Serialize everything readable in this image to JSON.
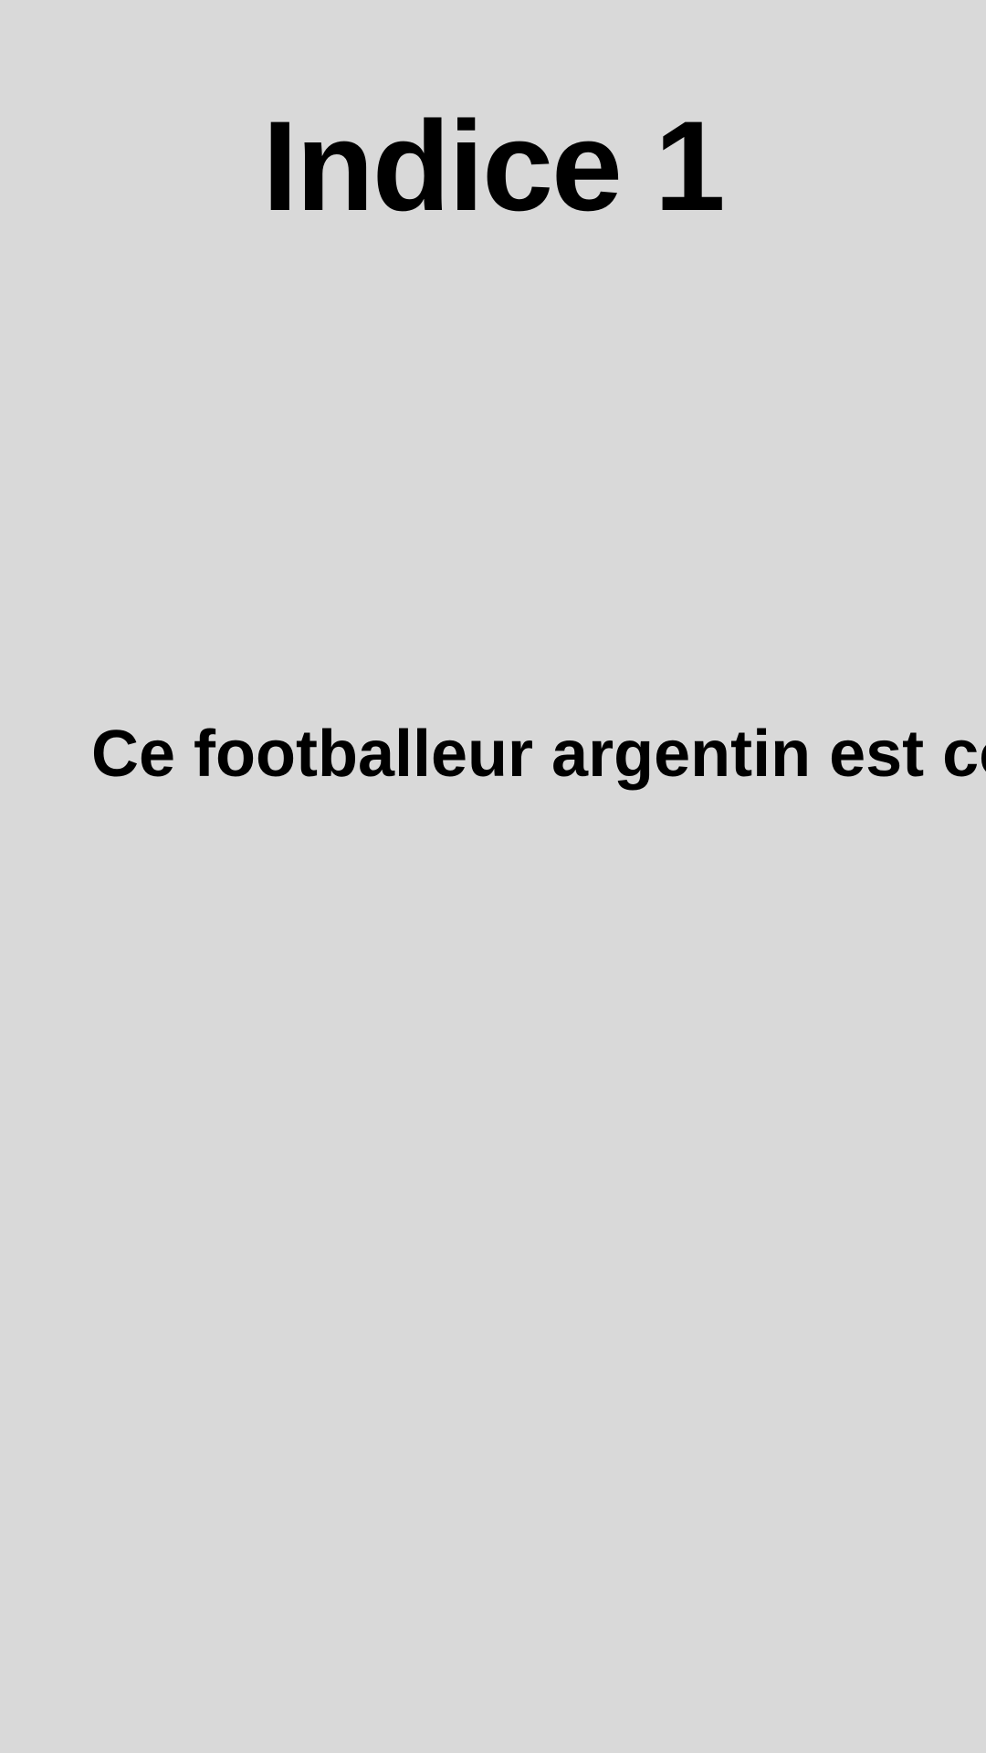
{
  "title": "Indice 1",
  "clue": "Ce footballeur argentin est co",
  "colors": {
    "background": "#d9d9d9",
    "text": "#000000"
  }
}
